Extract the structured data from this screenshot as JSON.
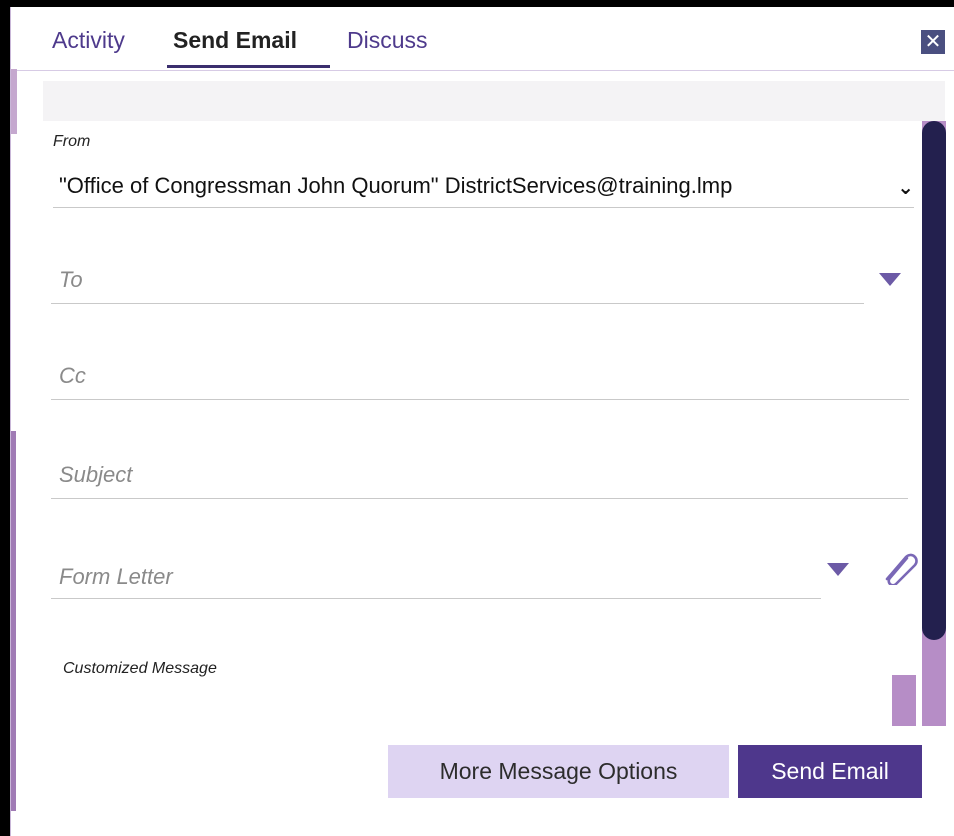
{
  "tabs": [
    {
      "label": "Activity",
      "active": false
    },
    {
      "label": "Send Email",
      "active": true
    },
    {
      "label": "Discuss",
      "active": false
    }
  ],
  "close_icon": "close-icon",
  "form": {
    "from_label": "From",
    "from_value": "\"Office of Congressman John Quorum\" DistrictServices@training.lmp",
    "to_placeholder": "To",
    "cc_placeholder": "Cc",
    "subject_placeholder": "Subject",
    "form_letter_placeholder": "Form Letter",
    "customized_message_label": "Customized Message"
  },
  "buttons": {
    "more_options": "More Message Options",
    "send": "Send Email"
  },
  "colors": {
    "accent": "#4e378c",
    "secondary_button": "#ded4f2",
    "scroll_thumb": "#23204e",
    "scroll_track": "#b68dc6"
  }
}
